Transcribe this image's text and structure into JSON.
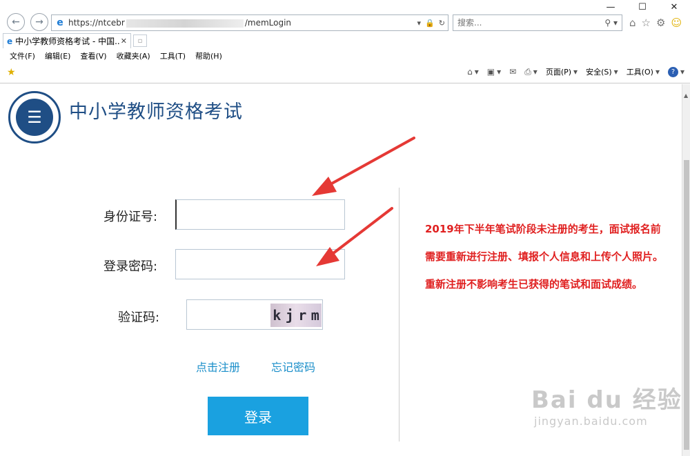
{
  "browser": {
    "url_visible_start": "https://ntcebr",
    "url_visible_end": "/memLogin",
    "search_placeholder": "搜索...",
    "tab_label": "中小学教师资格考试 - 中国...",
    "menu": [
      "文件(F)",
      "编辑(E)",
      "查看(V)",
      "收藏夹(A)",
      "工具(T)",
      "帮助(H)"
    ],
    "command": {
      "page": "页面(P)",
      "safety": "安全(S)",
      "tools": "工具(O)"
    }
  },
  "site": {
    "title": "中小学教师资格考试"
  },
  "form": {
    "id_label": "身份证号:",
    "pwd_label": "登录密码:",
    "captcha_label": "验证码:",
    "captcha_text": [
      "k",
      "j",
      "r",
      "m"
    ],
    "register_link": "点击注册",
    "forgot_link": "忘记密码",
    "login_button": "登录"
  },
  "notice": "2019年下半年笔试阶段未注册的考生，面试报名前需要重新进行注册、填报个人信息和上传个人照片。重新注册不影响考生已获得的笔试和面试成绩。",
  "watermark": {
    "main": "Bai du 经验",
    "sub": "jingyan.baidu.com"
  },
  "colors": {
    "brand_blue": "#1f4e85",
    "button_blue": "#1aa1e0",
    "link_blue": "#1a8ec9",
    "notice_red": "#e02020",
    "arrow_red": "#e53935"
  }
}
